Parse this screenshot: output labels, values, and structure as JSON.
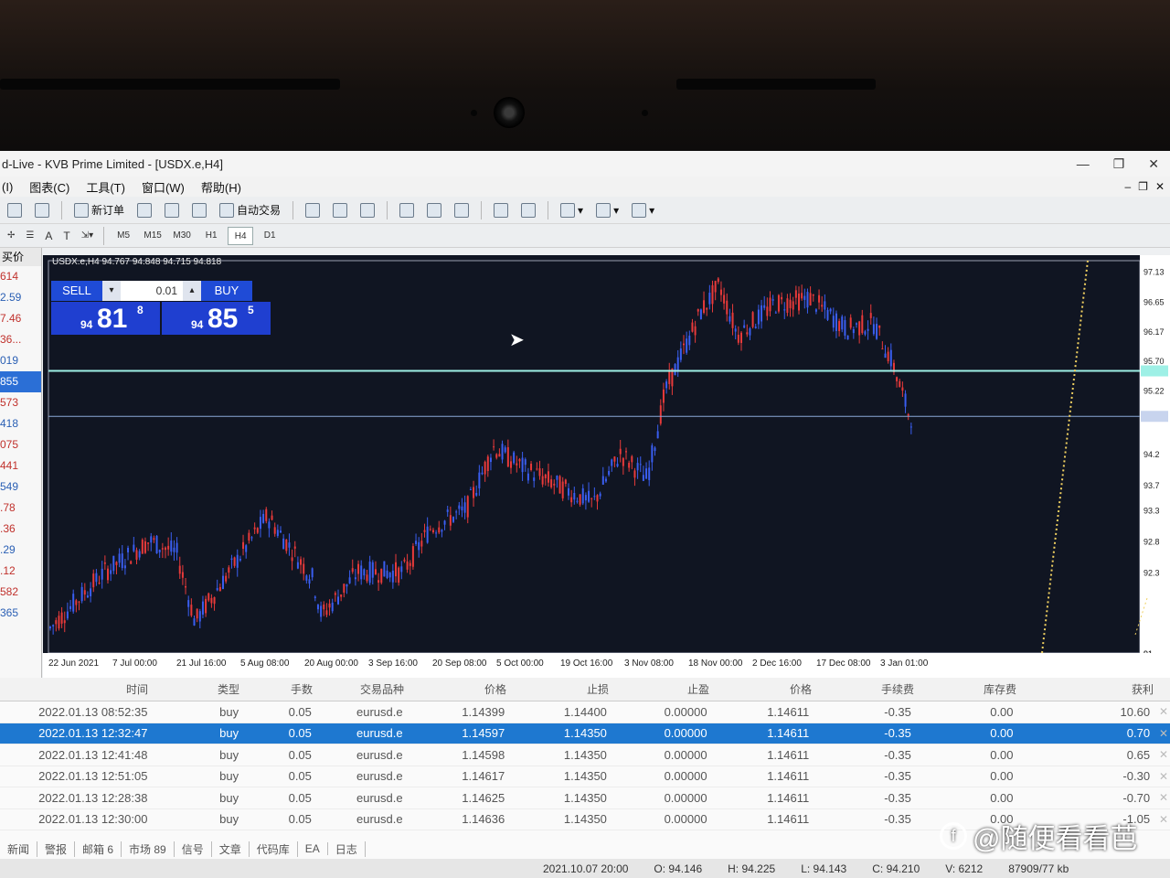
{
  "window": {
    "title": "d-Live - KVB Prime Limited - [USDX.e,H4]",
    "controls": [
      "—",
      "❐",
      "✕"
    ]
  },
  "menu": {
    "items": [
      "(I)",
      "图表(C)",
      "工具(T)",
      "窗口(W)",
      "帮助(H)"
    ]
  },
  "toolbar": {
    "new_order": "新订单",
    "autotrade": "自动交易"
  },
  "timeframes": [
    "M5",
    "M15",
    "M30",
    "H1",
    "H4",
    "D1"
  ],
  "timeframe_active": "H4",
  "watch": {
    "header": "买价",
    "rows": [
      "614",
      "2.59",
      "7.46",
      "36...",
      "019",
      "855",
      "573",
      "418",
      "075",
      "441",
      "549",
      ".78",
      ".36",
      ".29",
      ".12",
      "582",
      "365"
    ]
  },
  "chart": {
    "header": "USDX.e,H4  94.767 94.848 94.715 94.818",
    "ohlc": {
      "open": 94.767,
      "high": 94.848,
      "low": 94.715,
      "close": 94.818
    },
    "symbol": "USDX.e,H4",
    "price_labels": [
      "97.13",
      "96.65",
      "96.17",
      "95.70",
      "95.53",
      "95.22",
      "94.8",
      "94.2",
      "93.7",
      "93.3",
      "92.8",
      "92.3",
      "91.",
      "91."
    ],
    "time_labels": [
      "22 Jun 2021",
      "7 Jul 00:00",
      "21 Jul 16:00",
      "5 Aug 08:00",
      "20 Aug 00:00",
      "3 Sep 16:00",
      "20 Sep 08:00",
      "5 Oct 00:00",
      "19 Oct 16:00",
      "3 Nov 08:00",
      "18 Nov 00:00",
      "2 Dec 16:00",
      "17 Dec 08:00",
      "3 Jan 01:00"
    ],
    "colors": {
      "background": "#101522",
      "bull": "#3a5ef0",
      "bear": "#e83a3a",
      "line_level": "#9ef0e6",
      "bid_line": "#8aa8d8"
    }
  },
  "one_click": {
    "sell": "SELL",
    "buy": "BUY",
    "lot": "0.01",
    "sell_price": {
      "big": "94",
      "main": "81",
      "small": "8"
    },
    "buy_price": {
      "big": "94",
      "main": "85",
      "small": "5"
    }
  },
  "trades": {
    "columns": [
      "时间",
      "类型",
      "手数",
      "交易品种",
      "价格",
      "止损",
      "止盈",
      "价格",
      "手续费",
      "库存费",
      "获利"
    ],
    "rows": [
      [
        "2022.01.13 08:52:35",
        "buy",
        "0.05",
        "eurusd.e",
        "1.14399",
        "1.14400",
        "0.00000",
        "1.14611",
        "-0.35",
        "0.00",
        "10.60"
      ],
      [
        "2022.01.13 12:32:47",
        "buy",
        "0.05",
        "eurusd.e",
        "1.14597",
        "1.14350",
        "0.00000",
        "1.14611",
        "-0.35",
        "0.00",
        "0.70"
      ],
      [
        "2022.01.13 12:41:48",
        "buy",
        "0.05",
        "eurusd.e",
        "1.14598",
        "1.14350",
        "0.00000",
        "1.14611",
        "-0.35",
        "0.00",
        "0.65"
      ],
      [
        "2022.01.13 12:51:05",
        "buy",
        "0.05",
        "eurusd.e",
        "1.14617",
        "1.14350",
        "0.00000",
        "1.14611",
        "-0.35",
        "0.00",
        "-0.30"
      ],
      [
        "2022.01.13 12:28:38",
        "buy",
        "0.05",
        "eurusd.e",
        "1.14625",
        "1.14350",
        "0.00000",
        "1.14611",
        "-0.35",
        "0.00",
        "-0.70"
      ],
      [
        "2022.01.13 12:30:00",
        "buy",
        "0.05",
        "eurusd.e",
        "1.14636",
        "1.14350",
        "0.00000",
        "1.14611",
        "-0.35",
        "0.00",
        "-1.05"
      ]
    ],
    "selected_row": 1
  },
  "tabs": [
    "新闻",
    "警报",
    "邮箱 6",
    "市场 89",
    "信号",
    "文章",
    "代码库",
    "EA",
    "日志"
  ],
  "status": {
    "time": "2021.10.07 20:00",
    "open": "O: 94.146",
    "high": "H: 94.225",
    "low": "L: 94.143",
    "close": "C: 94.210",
    "volume": "V: 6212",
    "traffic": "87909/77 kb"
  },
  "watermark": "@随便看看芭"
}
